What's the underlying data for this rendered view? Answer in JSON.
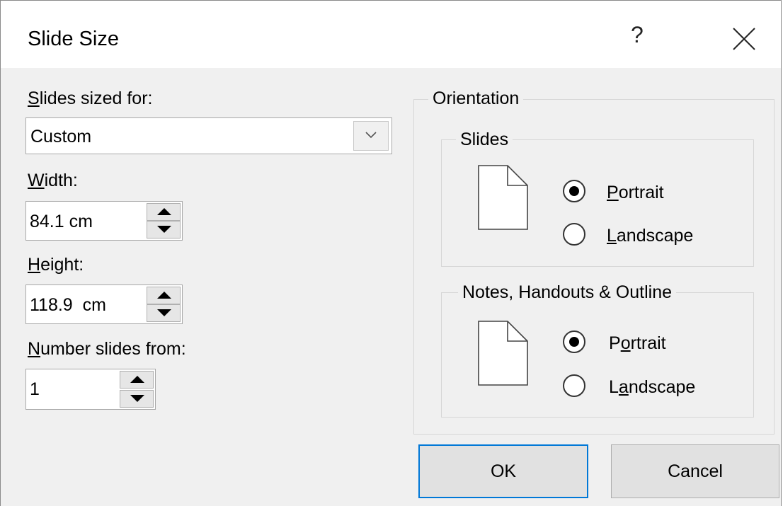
{
  "dialog": {
    "title": "Slide Size",
    "help": "?"
  },
  "left": {
    "sized_for": {
      "label_u": "S",
      "label_rest": "lides sized for:",
      "value": "Custom"
    },
    "width": {
      "label_u": "W",
      "label_rest": "idth:",
      "value": "84.1 cm"
    },
    "height": {
      "label_u": "H",
      "label_rest": "eight:",
      "value": "118.9  cm"
    },
    "number_from": {
      "label_u": "N",
      "label_rest": "umber slides from:",
      "value": "1"
    }
  },
  "orientation": {
    "title": "Orientation",
    "slides": {
      "title": "Slides",
      "portrait": {
        "u": "P",
        "rest": "ortrait",
        "checked": true
      },
      "landscape": {
        "u": "L",
        "rest": "andscape",
        "checked": false
      }
    },
    "notes": {
      "title": "Notes, Handouts & Outline",
      "portrait": {
        "pre": "P",
        "u": "o",
        "rest": "rtrait",
        "checked": true
      },
      "landscape": {
        "pre": "L",
        "u": "a",
        "rest": "ndscape",
        "checked": false
      }
    }
  },
  "buttons": {
    "ok": "OK",
    "cancel": "Cancel"
  },
  "colors": {
    "accent": "#0078d7",
    "background": "#f0f0f0"
  }
}
